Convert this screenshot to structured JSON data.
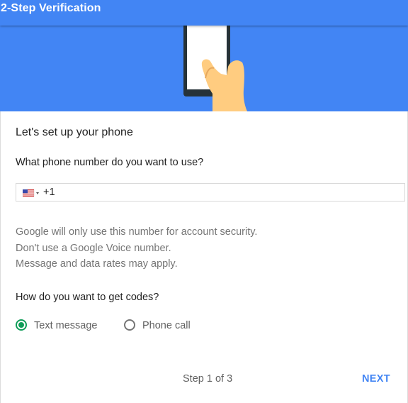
{
  "header": {
    "title": "2-Step Verification"
  },
  "colors": {
    "brand_blue": "#4285f4",
    "selected_green": "#0f9d58"
  },
  "banner": {
    "illustration": "hand-holding-phone-illustration"
  },
  "setup": {
    "heading": "Let's set up your phone",
    "phone_question": "What phone number do you want to use?",
    "phone_input": {
      "country_flag": "us-flag-icon",
      "country_code": "+1",
      "value": ""
    },
    "info_lines": [
      "Google will only use this number for account security.",
      "Don't use a Google Voice number.",
      "Message and data rates may apply."
    ],
    "codes_question": "How do you want to get codes?",
    "options": [
      {
        "label": "Text message",
        "selected": true
      },
      {
        "label": "Phone call",
        "selected": false
      }
    ]
  },
  "footer": {
    "step_text": "Step 1 of 3",
    "next_label": "NEXT"
  }
}
